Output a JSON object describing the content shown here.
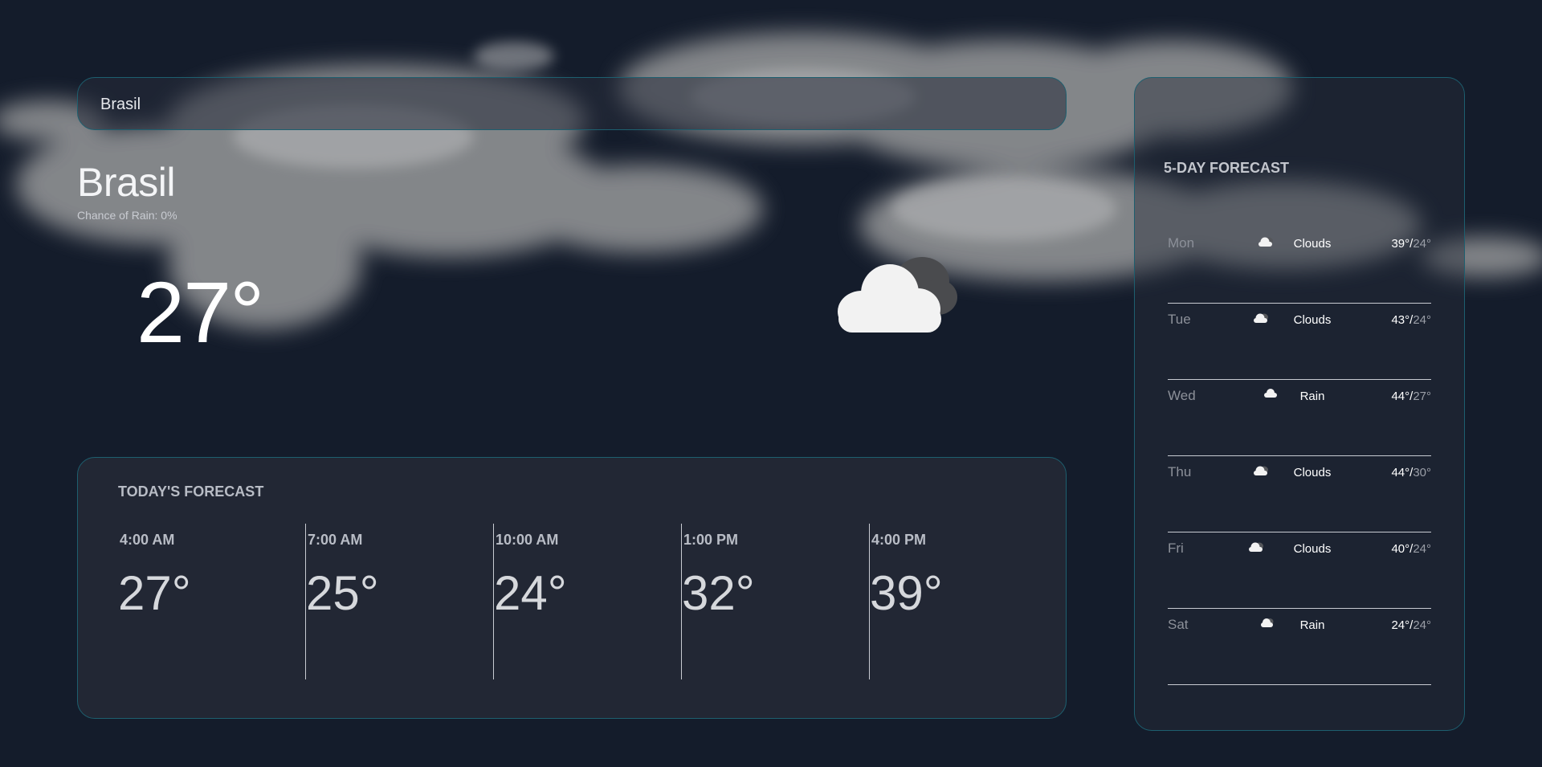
{
  "search": {
    "value": "Brasil"
  },
  "current": {
    "city": "Brasil",
    "rain_label": "Chance of Rain:",
    "rain_value": "0%",
    "temp": "27°",
    "icon": "cloud-icon"
  },
  "today": {
    "title": "TODAY'S FORECAST",
    "hours": [
      {
        "time": "4:00 AM",
        "temp": "27°"
      },
      {
        "time": "7:00 AM",
        "temp": "25°"
      },
      {
        "time": "10:00 AM",
        "temp": "24°"
      },
      {
        "time": "1:00 PM",
        "temp": "32°"
      },
      {
        "time": "4:00 PM",
        "temp": "39°"
      }
    ]
  },
  "week": {
    "title": "5-DAY FORECAST",
    "days": [
      {
        "day": "Mon",
        "condition": "Clouds",
        "high": "39°",
        "sep": "/",
        "low": "24°",
        "icon": "cloud-icon"
      },
      {
        "day": "Tue",
        "condition": "Clouds",
        "high": "43°",
        "sep": "/",
        "low": "24°",
        "icon": "cloud-icon"
      },
      {
        "day": "Wed",
        "condition": "Rain",
        "high": "44°",
        "sep": "/",
        "low": "27°",
        "icon": "rain-cloud-icon"
      },
      {
        "day": "Thu",
        "condition": "Clouds",
        "high": "44°",
        "sep": "/",
        "low": "30°",
        "icon": "cloud-icon"
      },
      {
        "day": "Fri",
        "condition": "Clouds",
        "high": "40°",
        "sep": "/",
        "low": "24°",
        "icon": "cloud-icon"
      },
      {
        "day": "Sat",
        "condition": "Rain",
        "high": "24°",
        "sep": "/",
        "low": "24°",
        "icon": "rain-cloud-icon"
      }
    ]
  },
  "colors": {
    "background": "#141c2b",
    "panel": "#222734",
    "panel_border": "#1d5f6f",
    "muted_text": "#9a9ea7"
  }
}
